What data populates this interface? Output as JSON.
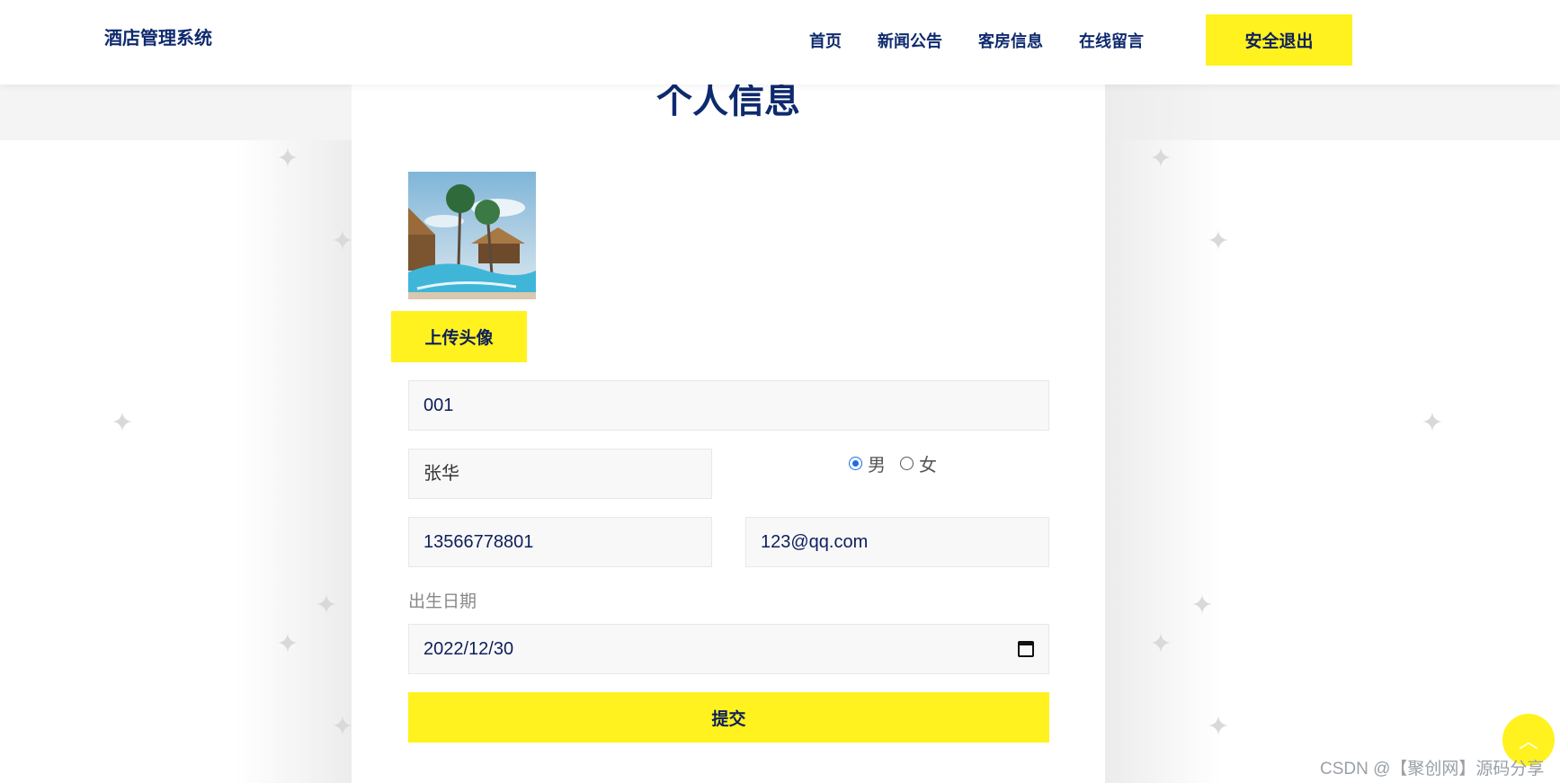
{
  "header": {
    "brand": "酒店管理系统",
    "nav": [
      "首页",
      "新闻公告",
      "客房信息",
      "在线留言"
    ],
    "logout_label": "安全退出"
  },
  "main": {
    "title": "个人信息",
    "upload_label": "上传头像",
    "fields": {
      "id": "001",
      "name": "张华",
      "phone": "13566778801",
      "email": "123@qq.com",
      "dob_label": "出生日期",
      "dob": "2022/12/30"
    },
    "gender": {
      "options": [
        "男",
        "女"
      ],
      "selected": "男"
    },
    "submit_label": "提交"
  },
  "watermark": "CSDN @【聚创网】源码分享",
  "colors": {
    "accent": "#fff21f",
    "navy": "#0e2a6e",
    "radio": "#1a6ee6"
  },
  "icons": [
    "calendar-icon",
    "arrow-up-icon",
    "sparkle-icon"
  ]
}
